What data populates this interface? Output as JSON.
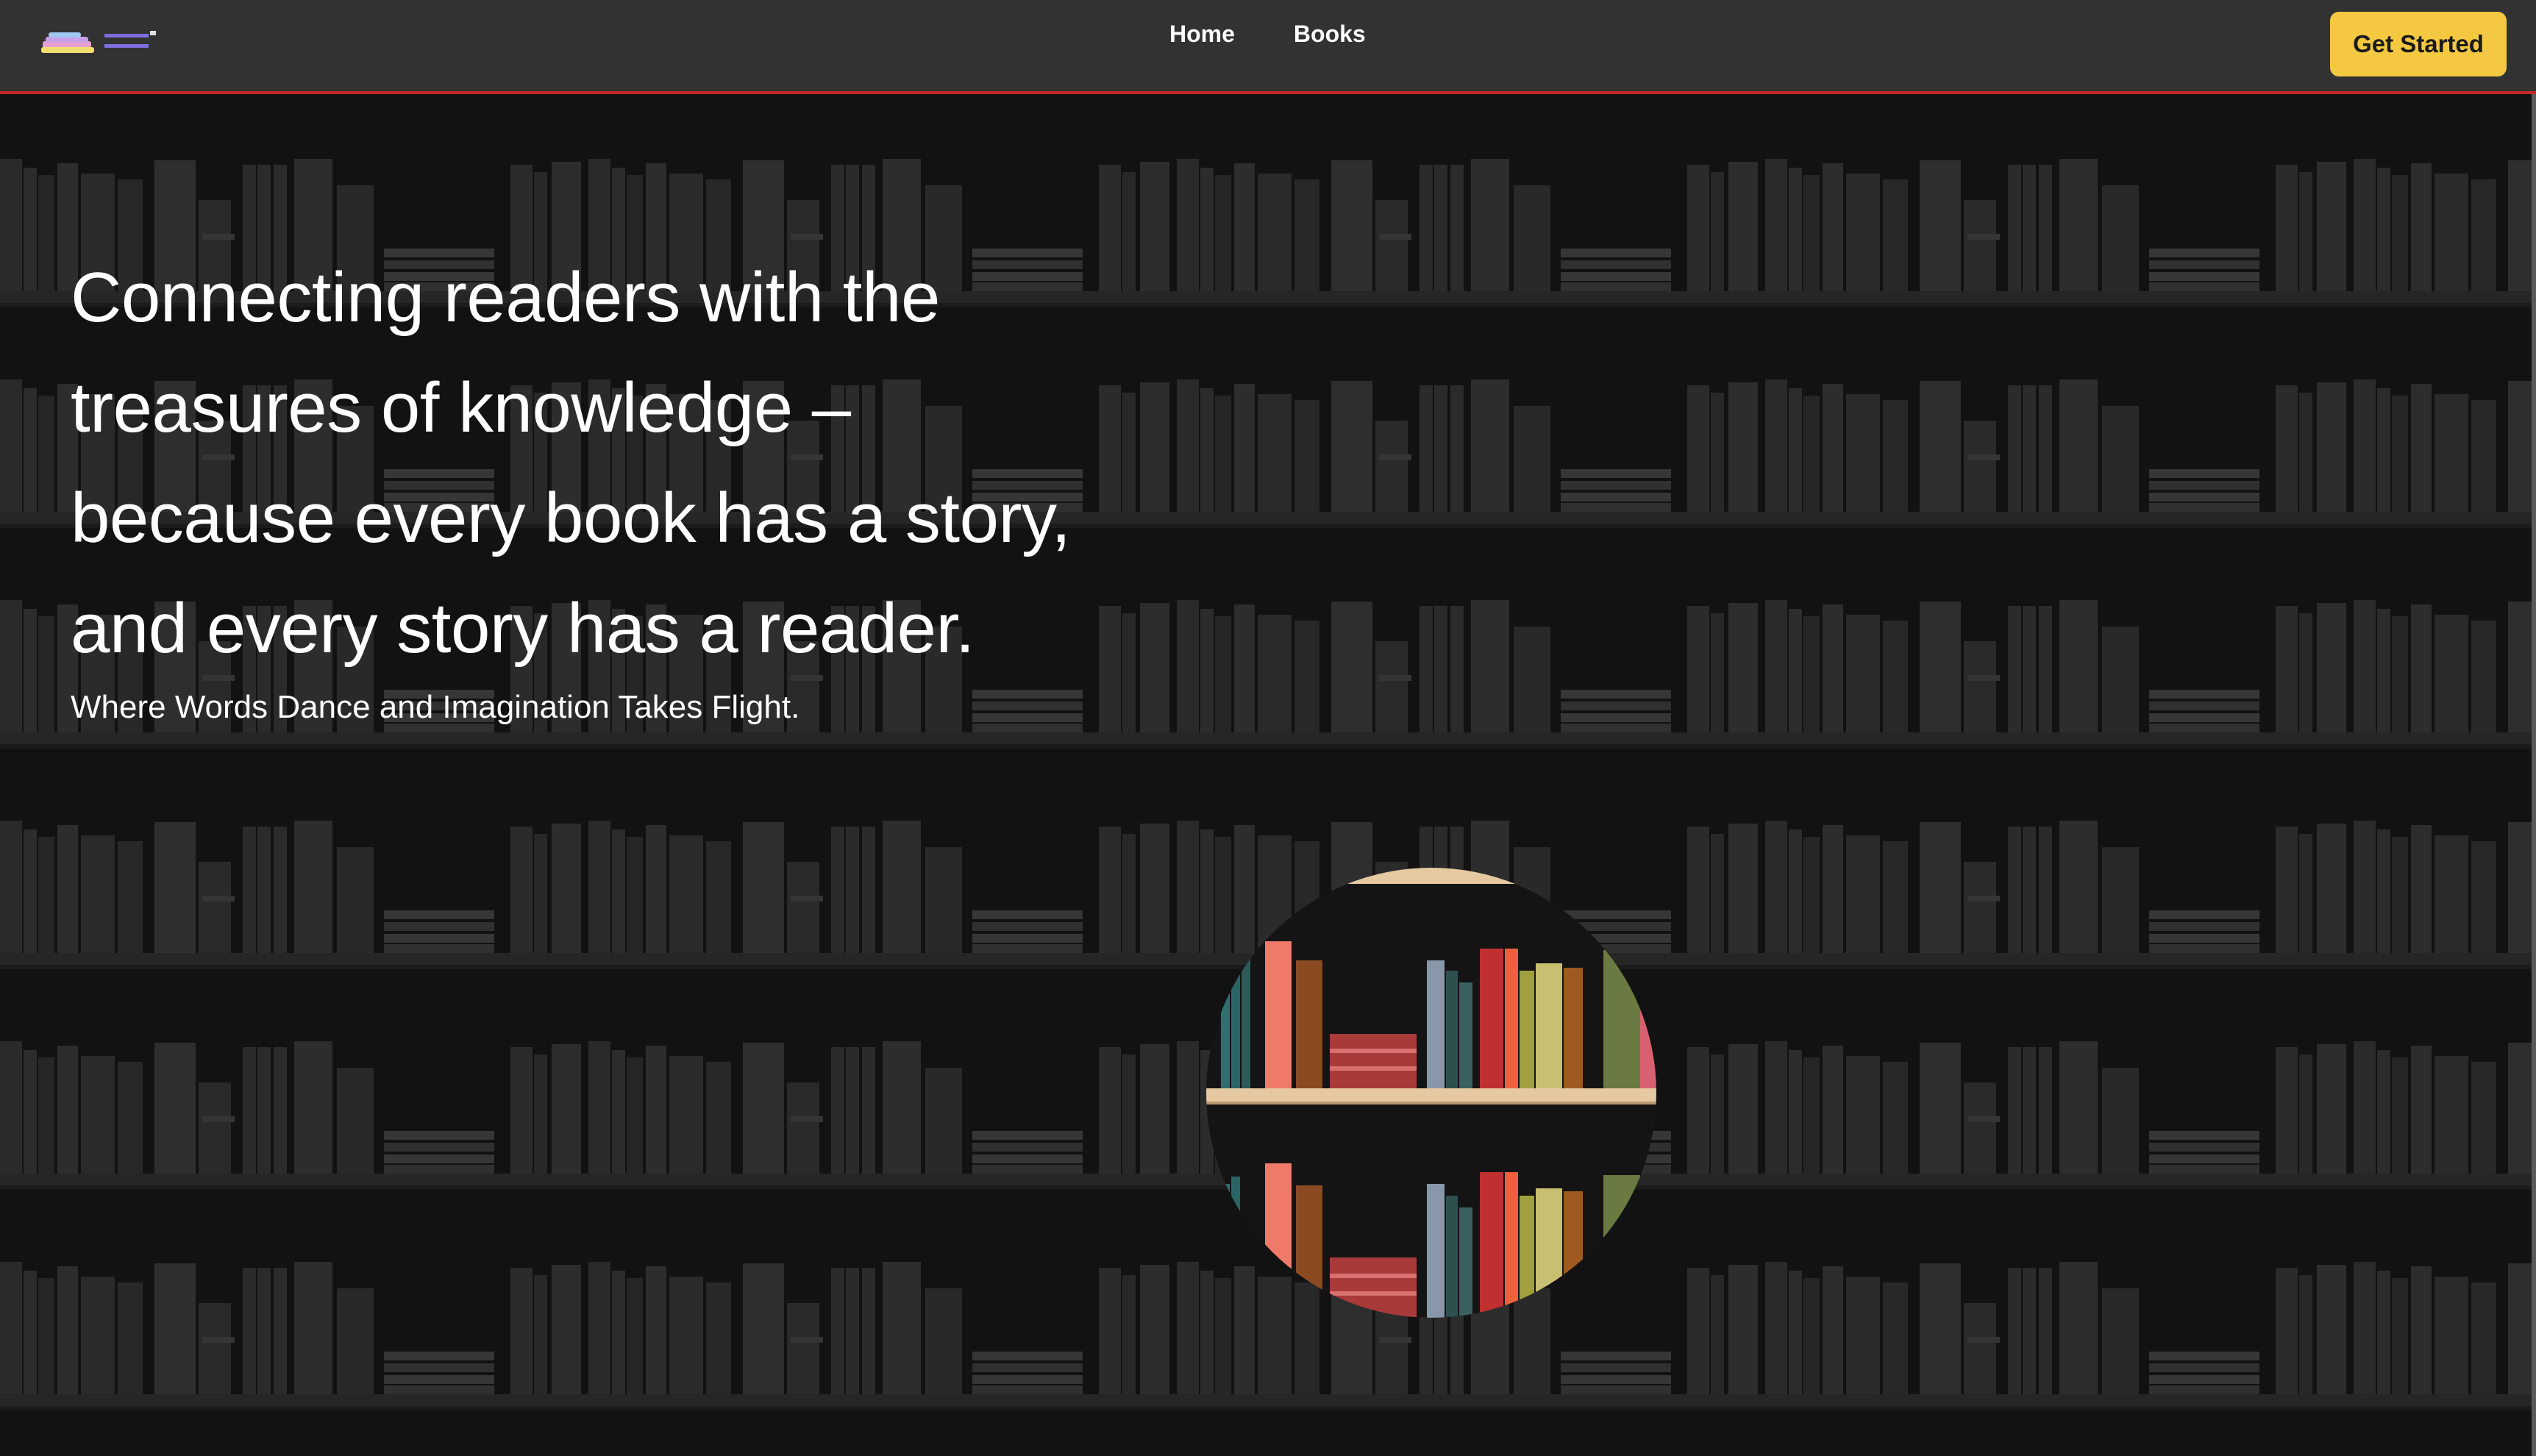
{
  "nav": {
    "logo_alt": "Book Nook",
    "links": [
      {
        "label": "Home"
      },
      {
        "label": "Books"
      }
    ],
    "cta_label": "Get Started"
  },
  "hero": {
    "title_lines": [
      "Connecting readers with the",
      "treasures of knowledge –",
      "because every book has a story,",
      "and every story has a reader."
    ],
    "subtitle": "Where Words Dance and Imagination Takes Flight."
  },
  "colors": {
    "navbar_bg": "#323232",
    "navbar_border": "#c62828",
    "page_bg": "#121212",
    "cta_bg": "#f5c842",
    "shelf_book": "#2a2a2a",
    "shelf_board": "#262626"
  },
  "icons": {
    "logo": "book-stack-logo-icon",
    "illustration": "bookshelf-circle-illustration"
  }
}
